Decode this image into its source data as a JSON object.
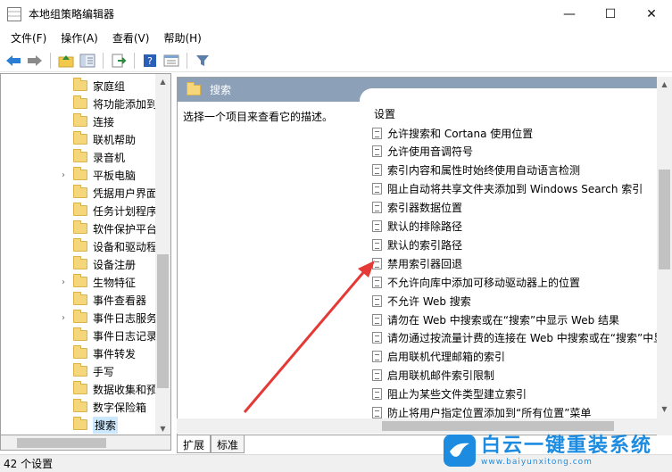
{
  "window": {
    "title": "本地组策略编辑器",
    "controls": {
      "minimize": "—",
      "maximize": "☐",
      "close": "✕"
    }
  },
  "menu": [
    "文件(F)",
    "操作(A)",
    "查看(V)",
    "帮助(H)"
  ],
  "toolbar": {
    "icons": [
      "back-icon",
      "forward-icon",
      "folder-up-icon",
      "tree-view-icon",
      "export-icon",
      "help-icon",
      "properties-icon",
      "filter-icon"
    ]
  },
  "tree": {
    "items": [
      {
        "label": "家庭组",
        "has_children": false,
        "selected": false
      },
      {
        "label": "将功能添加到",
        "has_children": false,
        "selected": false
      },
      {
        "label": "连接",
        "has_children": false,
        "selected": false
      },
      {
        "label": "联机帮助",
        "has_children": false,
        "selected": false
      },
      {
        "label": "录音机",
        "has_children": false,
        "selected": false
      },
      {
        "label": "平板电脑",
        "has_children": true,
        "selected": false
      },
      {
        "label": "凭据用户界面",
        "has_children": false,
        "selected": false
      },
      {
        "label": "任务计划程序",
        "has_children": false,
        "selected": false
      },
      {
        "label": "软件保护平台",
        "has_children": false,
        "selected": false
      },
      {
        "label": "设备和驱动程",
        "has_children": false,
        "selected": false
      },
      {
        "label": "设备注册",
        "has_children": false,
        "selected": false
      },
      {
        "label": "生物特征",
        "has_children": true,
        "selected": false
      },
      {
        "label": "事件查看器",
        "has_children": false,
        "selected": false
      },
      {
        "label": "事件日志服务",
        "has_children": true,
        "selected": false
      },
      {
        "label": "事件日志记录",
        "has_children": false,
        "selected": false
      },
      {
        "label": "事件转发",
        "has_children": false,
        "selected": false
      },
      {
        "label": "手写",
        "has_children": false,
        "selected": false
      },
      {
        "label": "数据收集和预",
        "has_children": false,
        "selected": false
      },
      {
        "label": "数字保险箱",
        "has_children": false,
        "selected": false
      },
      {
        "label": "搜索",
        "has_children": false,
        "selected": true
      }
    ]
  },
  "right_pane": {
    "header": "搜索",
    "description": "选择一个项目来查看它的描述。",
    "column_header": "设置",
    "settings": [
      "允许搜索和 Cortana 使用位置",
      "允许使用音调符号",
      "索引内容和属性时始终使用自动语言检测",
      "阻止自动将共享文件夹添加到 Windows Search 索引",
      "索引器数据位置",
      "默认的排除路径",
      "默认的索引路径",
      "禁用索引器回退",
      "不允许向库中添加可移动驱动器上的位置",
      "不允许 Web 搜索",
      "请勿在 Web 中搜索或在“搜索”中显示 Web 结果",
      "请勿通过按流量计费的连接在 Web 中搜索或在“搜索”中显",
      "启用联机代理邮箱的索引",
      "启用联机邮件索引限制",
      "阻止为某些文件类型建立索引",
      "防止将用户指定位置添加到“所有位置”菜单"
    ]
  },
  "tabs": [
    "扩展",
    "标准"
  ],
  "status": "42 个设置",
  "annotation": {
    "arrow_color": "#e53935"
  },
  "watermark": {
    "title": "白云一键重装系统",
    "url": "www.baiyunxitong.com"
  }
}
